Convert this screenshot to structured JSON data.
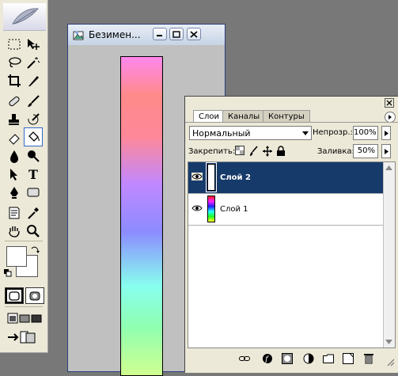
{
  "document": {
    "title": "Безимен..."
  },
  "layers_panel": {
    "tabs": [
      {
        "label": "Слои",
        "active": true
      },
      {
        "label": "Каналы",
        "active": false
      },
      {
        "label": "Контуры",
        "active": false
      }
    ],
    "blend_mode": "Нормальный",
    "opacity_label": "Непрозр.:",
    "opacity_value": "100%",
    "lock_label": "Закрепить:",
    "fill_label": "Заливка:",
    "fill_value": "50%",
    "layers": [
      {
        "name": "Слой 2",
        "selected": true,
        "visible": true
      },
      {
        "name": "Слой 1",
        "selected": false,
        "visible": true
      }
    ]
  },
  "toolbox": {
    "tools": [
      "marquee-icon",
      "move-icon",
      "lasso-icon",
      "magic-wand-icon",
      "crop-icon",
      "slice-icon",
      "healing-icon",
      "brush-icon",
      "stamp-icon",
      "history-brush-icon",
      "eraser-icon",
      "paint-bucket-icon",
      "blur-icon",
      "dodge-icon",
      "path-select-icon",
      "type-icon",
      "pen-icon",
      "shape-icon",
      "notes-icon",
      "eyedropper-icon",
      "hand-icon",
      "zoom-icon"
    ],
    "selected_tool": "paint-bucket-icon",
    "foreground_color": "#ffffff",
    "background_color": "#ffffff"
  },
  "colors": {
    "selected_layer_bg": "#163a6a",
    "workspace_bg": "#787878",
    "panel_bg": "#ece9d8"
  }
}
